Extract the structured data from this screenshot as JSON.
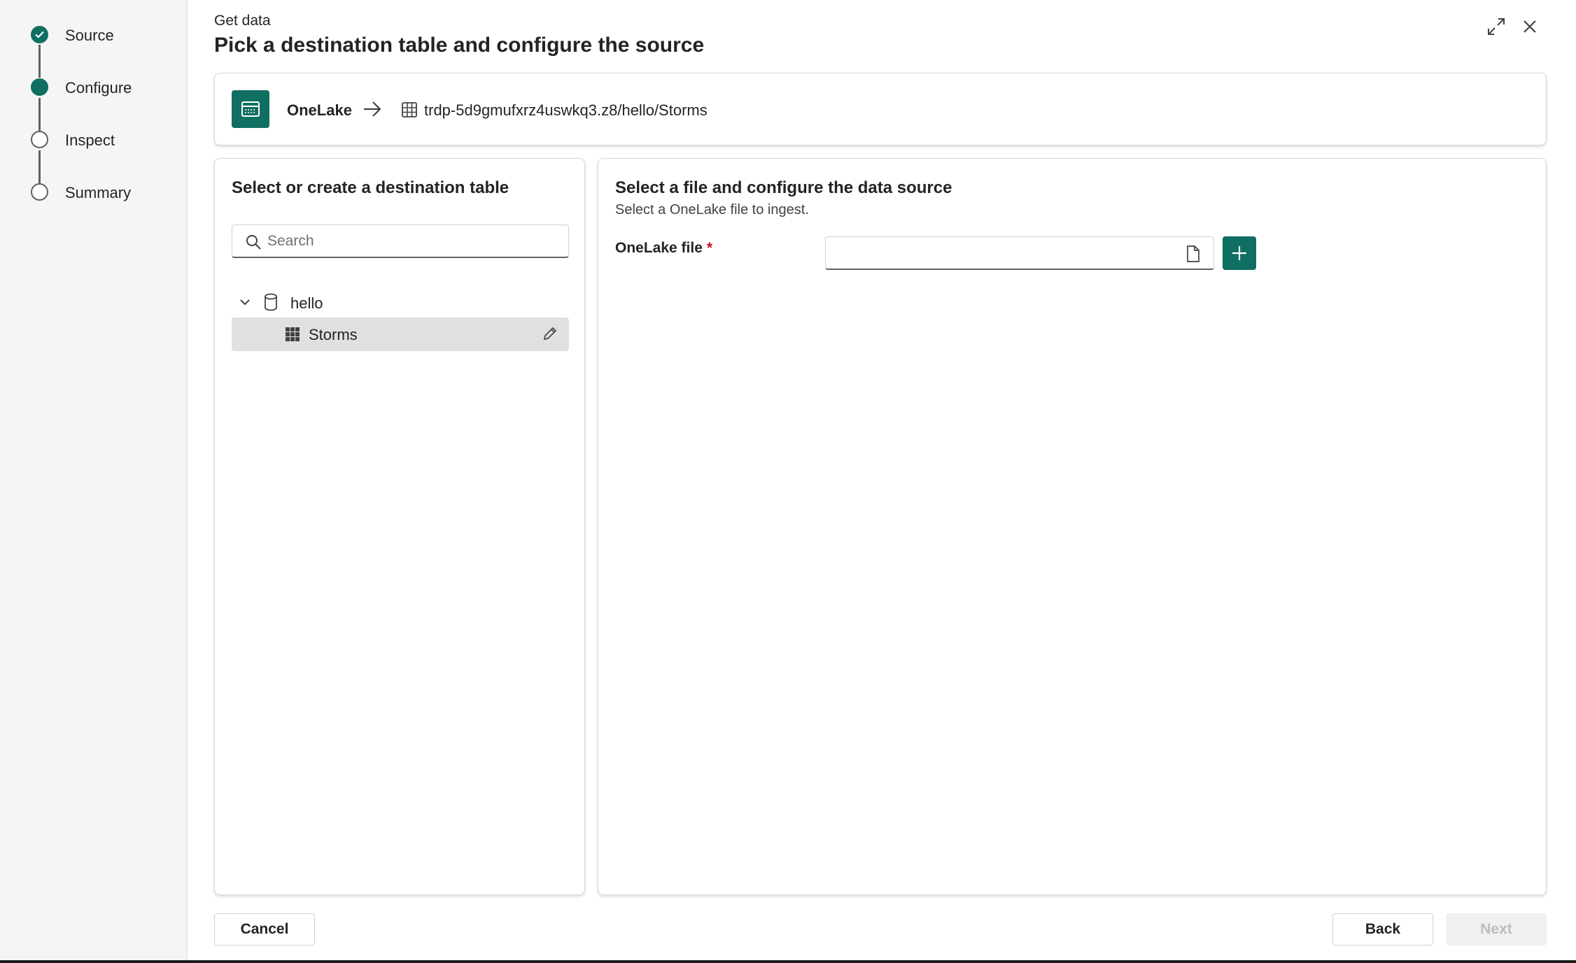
{
  "stepper": {
    "steps": [
      {
        "label": "Source",
        "state": "done"
      },
      {
        "label": "Configure",
        "state": "current"
      },
      {
        "label": "Inspect",
        "state": "pending"
      },
      {
        "label": "Summary",
        "state": "pending"
      }
    ]
  },
  "header": {
    "supertitle": "Get data",
    "title": "Pick a destination table and configure the source",
    "icons": [
      "expand-icon",
      "close-icon"
    ]
  },
  "source_bar": {
    "source_name": "OneLake",
    "destination_path": "trdp-5d9gmufxrz4uswkq3.z8/hello/Storms"
  },
  "left_panel": {
    "heading": "Select or create a destination table",
    "search_placeholder": "Search",
    "database": {
      "name": "hello",
      "expanded": true
    },
    "tables": [
      {
        "name": "Storms",
        "selected": true
      }
    ]
  },
  "right_panel": {
    "heading": "Select a file and configure the data source",
    "subheading": "Select a OneLake file to ingest.",
    "field_label": "OneLake file",
    "required_marker": "*",
    "file_value": ""
  },
  "footer": {
    "cancel_label": "Cancel",
    "back_label": "Back",
    "next_label": "Next",
    "next_disabled": true
  },
  "colors": {
    "accent": "#0f6f62",
    "required": "#c50f1f"
  }
}
